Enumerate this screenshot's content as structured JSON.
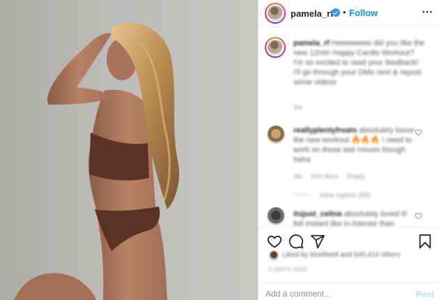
{
  "header": {
    "username": "pamela_rf",
    "separator": "•",
    "follow_label": "Follow",
    "more_icon": "⋯"
  },
  "caption": {
    "username": "pamela_rf",
    "text": "Heeeeeeee did you like the new 12min Happy Cardio Workout? I'm so excited to read your feedback! I'll go through your DMs next & repost some videos",
    "time": "3w"
  },
  "comments": [
    {
      "username": "reallyplentyfreats",
      "text": "absolutely loove the new workout 🔥🔥🔥 I need to work on those last moves though haha",
      "time": "3w",
      "likes": "540 likes",
      "reply": "Reply",
      "view_replies": "View replies (65)"
    },
    {
      "username": "itsjust_celine",
      "text": "absolutely loved it! felt instant like in-intense than"
    }
  ],
  "likes_text": "Liked by kinellstell and 540,414 others",
  "timestamp": "3 DAYS AGO",
  "add_comment": {
    "placeholder": "Add a comment...",
    "post_label": "Post"
  },
  "colors": {
    "link_blue": "#0095f6",
    "post_disabled": "#b2dffc",
    "text": "#262626",
    "muted": "#8e8e8e"
  },
  "icons": [
    "heart-icon",
    "comment-icon",
    "share-icon",
    "bookmark-icon",
    "verified-badge-icon",
    "more-options-icon"
  ]
}
